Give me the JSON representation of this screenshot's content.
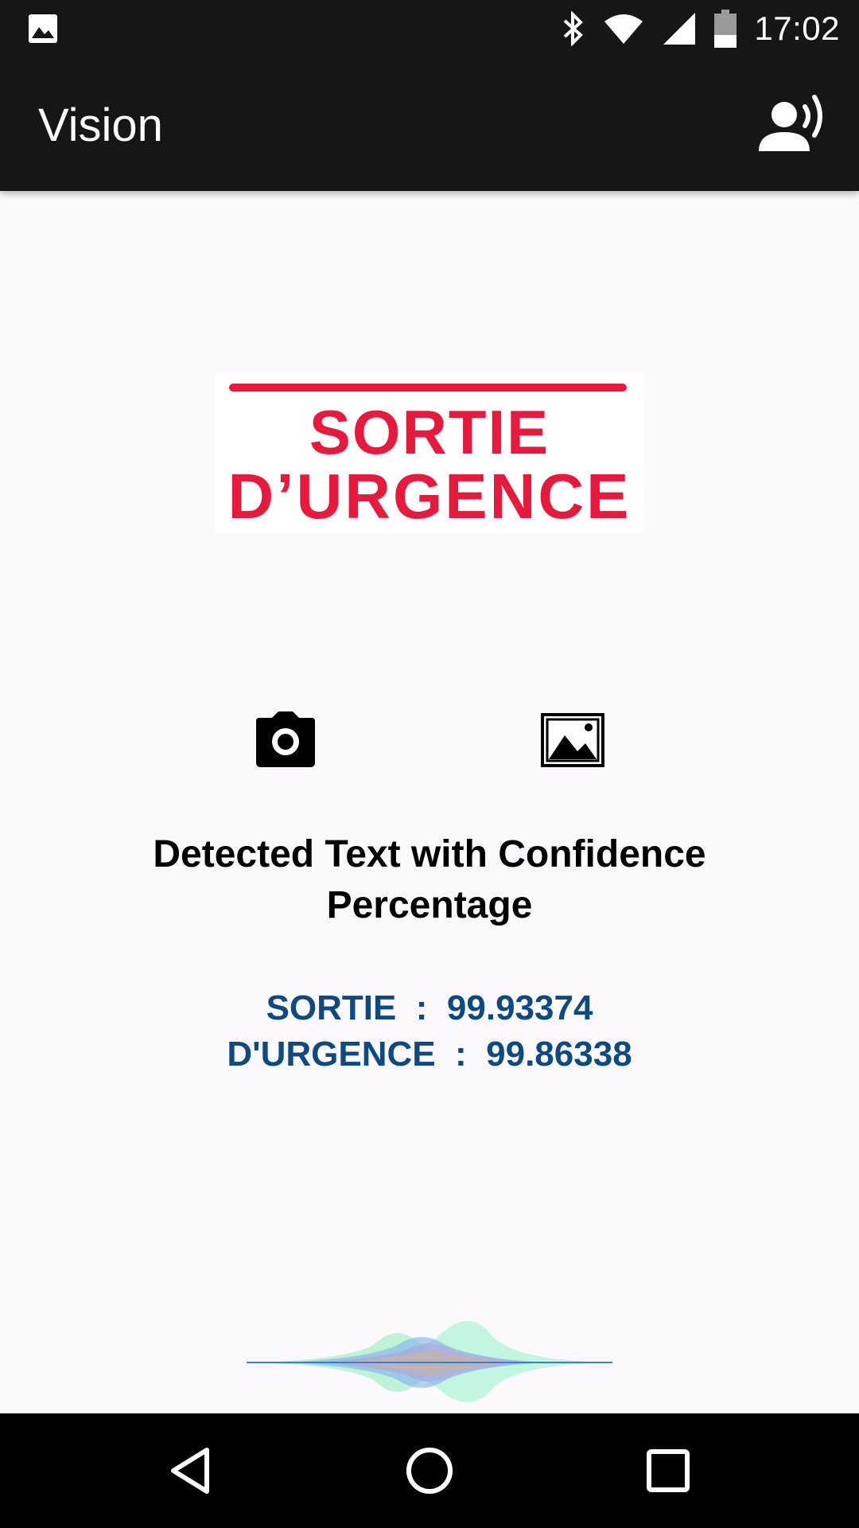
{
  "status_bar": {
    "time": "17:02",
    "icons": [
      "image-notification-icon",
      "bluetooth-icon",
      "wifi-icon",
      "signal-icon",
      "battery-icon"
    ]
  },
  "app_bar": {
    "title": "Vision",
    "action_icon": "voice-person-icon"
  },
  "sign_image": {
    "line1": "SORTIE",
    "line2": "D’URGENCE",
    "color": "#e8193d"
  },
  "actions": {
    "camera_icon": "camera-icon",
    "gallery_icon": "gallery-icon"
  },
  "results": {
    "title_line1": "Detected Text with Confidence",
    "title_line2": "Percentage",
    "rows": [
      {
        "text": "SORTIE  :  99.93374"
      },
      {
        "text": "D'URGENCE  :  99.86338"
      }
    ],
    "color": "#0e4a82"
  },
  "navigation": {
    "icons": [
      "back-icon",
      "home-icon",
      "recents-icon"
    ]
  }
}
